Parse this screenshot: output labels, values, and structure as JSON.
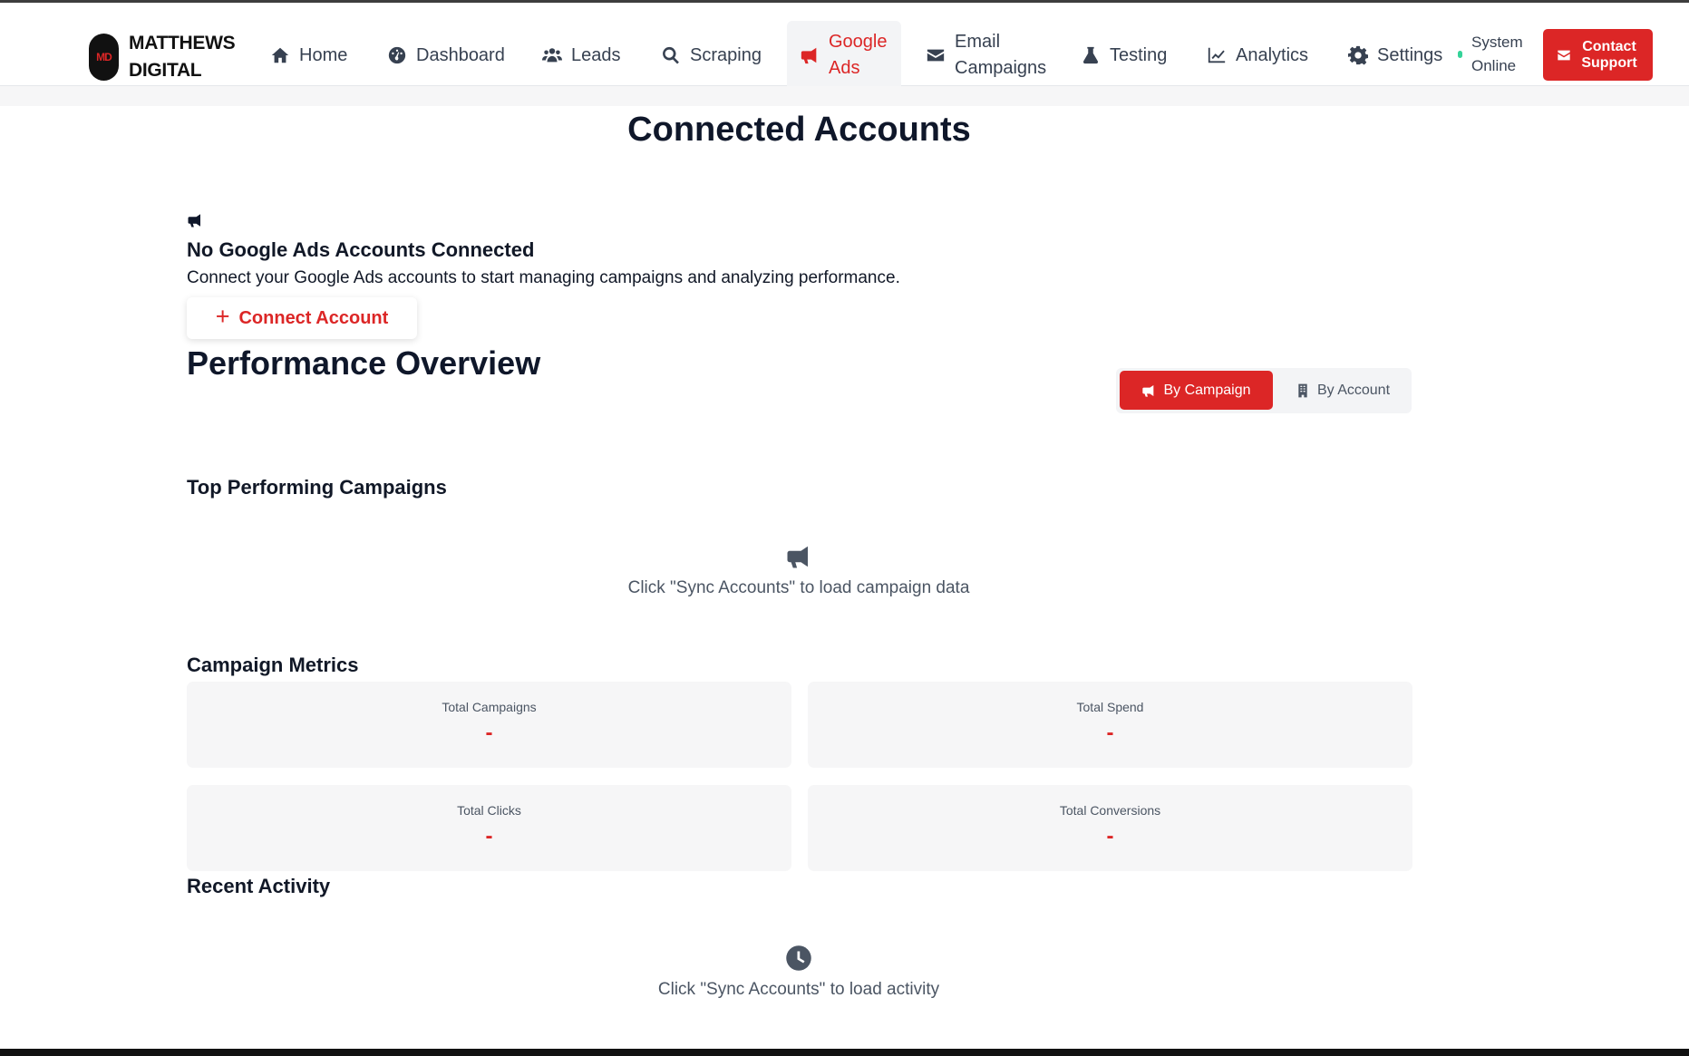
{
  "brand": {
    "logo_text": "MD",
    "name": "MATTHEWS DIGITAL"
  },
  "nav": {
    "home": "Home",
    "dashboard": "Dashboard",
    "leads": "Leads",
    "scraping": "Scraping",
    "google_ads": "Google Ads",
    "email_campaigns": "Email Campaigns",
    "testing": "Testing",
    "analytics": "Analytics",
    "settings": "Settings",
    "active_item": "Google Ads"
  },
  "status": {
    "text": "System Online",
    "color": "#34d399"
  },
  "contact_button": "Contact Support",
  "page_title": "Connected Accounts",
  "empty_state": {
    "icon": "megaphone-icon",
    "title": "No Google Ads Accounts Connected",
    "description": "Connect your Google Ads accounts to start managing campaigns and analyzing performance.",
    "button": "Connect Account"
  },
  "performance": {
    "title": "Performance Overview",
    "toggle": {
      "by_campaign": "By Campaign",
      "by_account": "By Account",
      "selected": "By Campaign"
    }
  },
  "top_campaigns": {
    "title": "Top Performing Campaigns",
    "empty_message": "Click \"Sync Accounts\" to load campaign data"
  },
  "campaign_metrics": {
    "title": "Campaign Metrics",
    "cards": [
      {
        "label": "Total Campaigns",
        "value": "-"
      },
      {
        "label": "Total Spend",
        "value": "-"
      },
      {
        "label": "Total Clicks",
        "value": "-"
      },
      {
        "label": "Total Conversions",
        "value": "-"
      }
    ]
  },
  "recent_activity": {
    "title": "Recent Activity",
    "empty_message": "Click \"Sync Accounts\" to load activity"
  },
  "colors": {
    "accent": "#dc2626",
    "text": "#111827",
    "muted": "#4b5563",
    "card_bg": "#f6f6f7"
  }
}
